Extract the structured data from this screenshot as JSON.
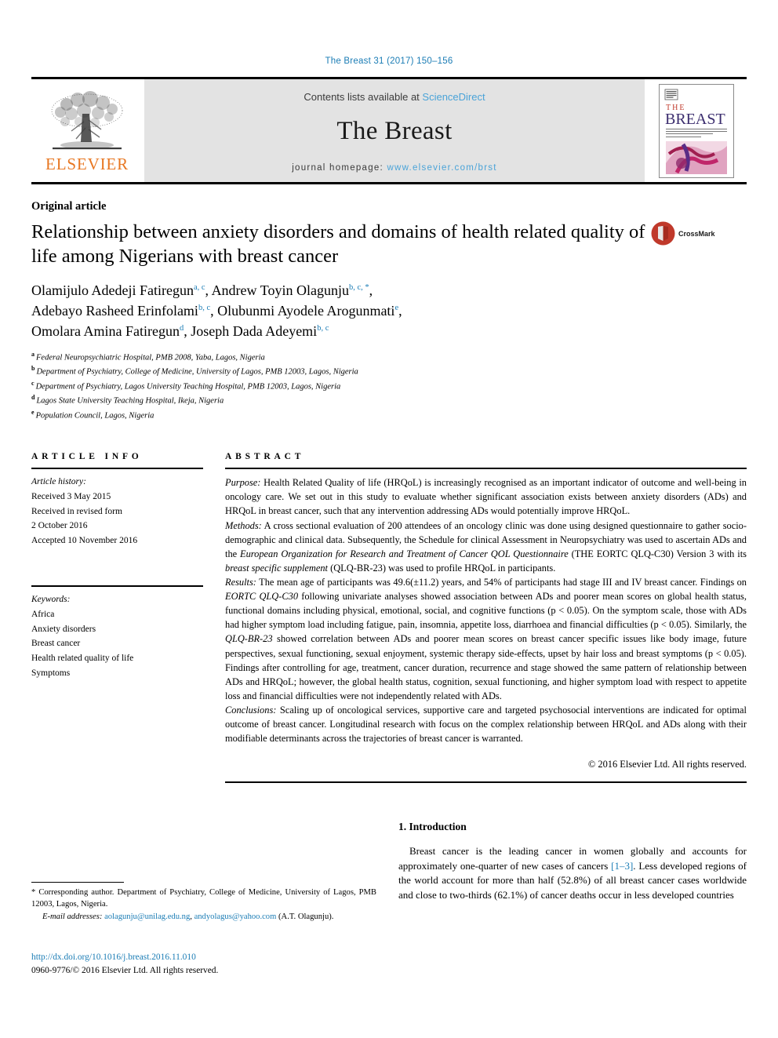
{
  "running_head": "The Breast 31 (2017) 150–156",
  "masthead": {
    "publisher_name": "ELSEVIER",
    "contents_prefix": "Contents lists available at ",
    "contents_link": "ScienceDirect",
    "journal_title": "The Breast",
    "homepage_prefix": "journal homepage: ",
    "homepage_url": "www.elsevier.com/brst",
    "cover_title_top": "THE",
    "cover_title_main": "BREAST"
  },
  "article": {
    "type": "Original article",
    "title": "Relationship between anxiety disorders and domains of health related quality of life among Nigerians with breast cancer",
    "crossmark_label": "CrossMark",
    "authors": [
      {
        "name": "Olamijulo Adedeji Fatiregun",
        "marks": "a, c",
        "sep": ", "
      },
      {
        "name": "Andrew Toyin Olagunju",
        "marks": "b, c, *",
        "sep": ","
      },
      {
        "name": "Adebayo Rasheed Erinfolami",
        "marks": "b, c",
        "sep": ", "
      },
      {
        "name": "Olubunmi Ayodele Arogunmati",
        "marks": "e",
        "sep": ","
      },
      {
        "name": "Omolara Amina Fatiregun",
        "marks": "d",
        "sep": ", "
      },
      {
        "name": "Joseph Dada Adeyemi",
        "marks": "b, c",
        "sep": ""
      }
    ],
    "affiliations": [
      {
        "marker": "a",
        "text": "Federal Neuropsychiatric Hospital, PMB 2008, Yaba, Lagos, Nigeria"
      },
      {
        "marker": "b",
        "text": "Department of Psychiatry, College of Medicine, University of Lagos, PMB 12003, Lagos, Nigeria"
      },
      {
        "marker": "c",
        "text": "Department of Psychiatry, Lagos University Teaching Hospital, PMB 12003, Lagos, Nigeria"
      },
      {
        "marker": "d",
        "text": "Lagos State University Teaching Hospital, Ikeja, Nigeria"
      },
      {
        "marker": "e",
        "text": "Population Council, Lagos, Nigeria"
      }
    ]
  },
  "article_info": {
    "heading": "ARTICLE INFO",
    "history_label": "Article history:",
    "history_lines": [
      "Received 3 May 2015",
      "Received in revised form",
      "2 October 2016",
      "Accepted 10 November 2016"
    ],
    "keywords_label": "Keywords:",
    "keywords": [
      "Africa",
      "Anxiety disorders",
      "Breast cancer",
      "Health related quality of life",
      "Symptoms"
    ]
  },
  "abstract": {
    "heading": "ABSTRACT",
    "purpose_label": "Purpose:",
    "purpose_text": " Health Related Quality of life (HRQoL) is increasingly recognised as an important indicator of outcome and well-being in oncology care. We set out in this study to evaluate whether significant association exists between anxiety disorders (ADs) and HRQoL in breast cancer, such that any intervention addressing ADs would potentially improve HRQoL.",
    "methods_label": "Methods:",
    "methods_text_1": " A cross sectional evaluation of 200 attendees of an oncology clinic was done using designed questionnaire to gather socio-demographic and clinical data. Subsequently, the Schedule for clinical Assessment in Neuropsychiatry was used to ascertain ADs and the ",
    "methods_italic_1": "European Organization for Research and Treatment of Cancer QOL Questionnaire",
    "methods_text_2": " (THE EORTC QLQ-C30) Version 3 with its ",
    "methods_italic_2": "breast specific supplement",
    "methods_text_3": " (QLQ-BR-23) was used to profile HRQoL in participants.",
    "results_label": "Results:",
    "results_text_1": " The mean age of participants was 49.6(±11.2) years, and 54% of participants had stage III and IV breast cancer. Findings on ",
    "results_italic_1": "EORTC QLQ-C30",
    "results_text_2": " following univariate analyses showed association between ADs and poorer mean scores on global health status, functional domains including physical, emotional, social, and cognitive functions (p < 0.05). On the symptom scale, those with ADs had higher symptom load including fatigue, pain, insomnia, appetite loss, diarrhoea and financial difficulties (p < 0.05). Similarly, the ",
    "results_italic_2": "QLQ-BR-23",
    "results_text_3": " showed correlation between ADs and poorer mean scores on breast cancer specific issues like body image, future perspectives, sexual functioning, sexual enjoyment, systemic therapy side-effects, upset by hair loss and breast symptoms (p < 0.05). Findings after controlling for age, treatment, cancer duration, recurrence and stage showed the same pattern of relationship between ADs and HRQoL; however, the global health status, cognition, sexual functioning, and higher symptom load with respect to appetite loss and financial difficulties were not independently related with ADs.",
    "conclusions_label": "Conclusions:",
    "conclusions_text": " Scaling up of oncological services, supportive care and targeted psychosocial interventions are indicated for optimal outcome of breast cancer. Longitudinal research with focus on the complex relationship between HRQoL and ADs along with their modifiable determinants across the trajectories of breast cancer is warranted.",
    "copyright": "© 2016 Elsevier Ltd. All rights reserved."
  },
  "introduction": {
    "heading": "1. Introduction",
    "para_1": "Breast cancer is the leading cancer in women globally and accounts for approximately one-quarter of new cases of cancers ",
    "citation_1": "[1–3]",
    "para_2": ". Less developed regions of the world account for more than half (52.8%) of all breast cancer cases worldwide and close to two-thirds (62.1%) of cancer deaths occur in less developed countries"
  },
  "footnotes": {
    "corresponding_star": "*",
    "corresponding_text": " Corresponding author. Department of Psychiatry, College of Medicine, University of Lagos, PMB 12003, Lagos, Nigeria.",
    "email_label": "E-mail addresses:",
    "email_1": "aolagunju@unilag.edu.ng",
    "email_sep": ", ",
    "email_2": "andyolagus@yahoo.com",
    "email_attrib": "(A.T. Olagunju).",
    "doi": "http://dx.doi.org/10.1016/j.breast.2016.11.010",
    "issn_line_prefix": "0960-9776/",
    "issn_line_rest": "© 2016 Elsevier Ltd. All rights reserved."
  },
  "colors": {
    "link_blue": "#1a7cb5",
    "sciencedirect_blue": "#4aa3d8",
    "elsevier_orange": "#E87722",
    "masthead_grey": "#e3e3e3",
    "crossmark_red": "#c0392b"
  }
}
